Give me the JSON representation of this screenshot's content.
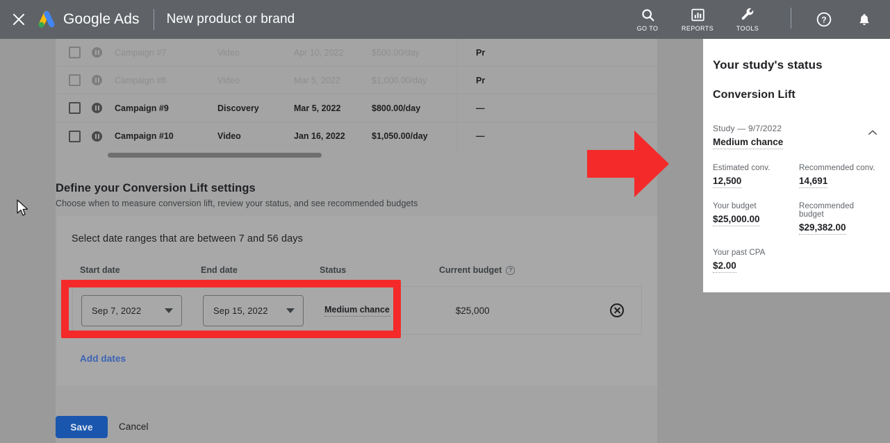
{
  "topbar": {
    "close_label": "close-icon",
    "brand_google": "Google",
    "brand_ads": "Ads",
    "page_title": "New product or brand",
    "tools": [
      {
        "icon": "search-icon",
        "label": "GO TO"
      },
      {
        "icon": "bar-chart-icon",
        "label": "REPORTS"
      },
      {
        "icon": "wrench-icon",
        "label": "TOOLS"
      }
    ],
    "help_icon": "help-icon",
    "bell_icon": "notifications-bell-icon"
  },
  "campaign_table": {
    "rows": [
      {
        "name": "Campaign #7",
        "type": "Video",
        "date": "Apr 10, 2022",
        "budget": "$500.00/day",
        "status": "Pr",
        "dimmed": true
      },
      {
        "name": "Campaign #8",
        "type": "Video",
        "date": "Mar 5, 2022",
        "budget": "$1,000.00/day",
        "status": "Pr",
        "dimmed": true
      },
      {
        "name": "Campaign #9",
        "type": "Discovery",
        "date": "Mar 5, 2022",
        "budget": "$800.00/day",
        "status": "—",
        "dimmed": false
      },
      {
        "name": "Campaign #10",
        "type": "Video",
        "date": "Jan 16, 2022",
        "budget": "$1,050.00/day",
        "status": "—",
        "dimmed": false
      }
    ]
  },
  "section": {
    "title": "Define your Conversion Lift settings",
    "subtitle": "Choose when to measure conversion lift, review your status, and see recommended budgets"
  },
  "settings_card": {
    "instruction": "Select date ranges that are between 7 and 56 days",
    "columns": {
      "start_date": "Start date",
      "end_date": "End date",
      "status": "Status",
      "current_budget": "Current budget",
      "budget_help_glyph": "?"
    },
    "row": {
      "start_date_value": "Sep 7, 2022",
      "end_date_value": "Sep 15, 2022",
      "status_value": "Medium chance",
      "current_budget_value": "$25,000",
      "remove_label": "remove-date-range"
    },
    "add_dates_label": "Add dates"
  },
  "footer": {
    "save_label": "Save",
    "cancel_label": "Cancel"
  },
  "rail": {
    "heading": "Your study's status",
    "subheading": "Conversion Lift",
    "study_line": "Study — 9/7/2022",
    "chance": "Medium chance",
    "collapse_icon": "chevron-up-icon",
    "metrics": [
      {
        "label": "Estimated conv.",
        "value": "12,500"
      },
      {
        "label": "Recommended conv.",
        "value": "14,691"
      },
      {
        "label": "Your budget",
        "value": "$25,000.00"
      },
      {
        "label": "Recommended budget",
        "value": "$29,382.00"
      },
      {
        "label": "Your past CPA",
        "value": "$2.00"
      }
    ]
  },
  "annotations": {
    "arrow_color": "#f42a2a",
    "box_color": "#f42a2a",
    "arrow_name": "red-pointer-arrow",
    "box_name": "red-highlight-box"
  }
}
